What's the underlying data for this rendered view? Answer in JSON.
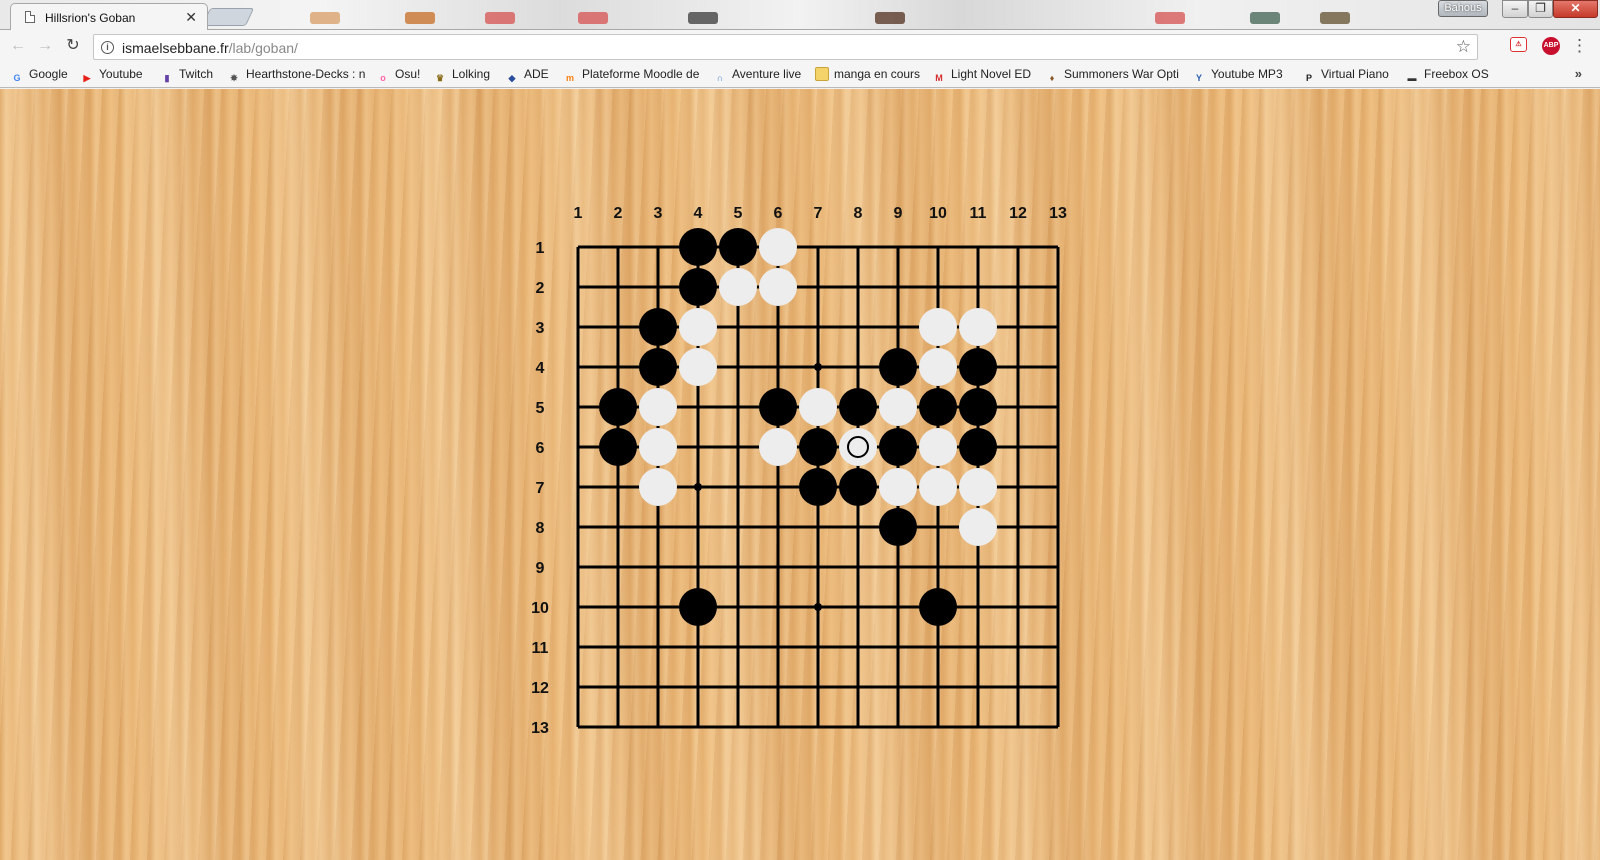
{
  "browser": {
    "tab_title": "Hillsrion's Goban",
    "tab_close": "✕",
    "user_button": "Bahous",
    "url_host": "ismaelsebbane.fr",
    "url_path": "/lab/goban/",
    "ext_abp": "ABP"
  },
  "bookmarks": [
    {
      "label": "Google",
      "icon": "google-icon",
      "color": "#4285f4",
      "glyph": "G"
    },
    {
      "label": "Youtube",
      "icon": "youtube-icon",
      "color": "#e62117",
      "glyph": "▶"
    },
    {
      "label": "Twitch",
      "icon": "twitch-icon",
      "color": "#6441a5",
      "glyph": "▮"
    },
    {
      "label": "Hearthstone-Decks : n",
      "icon": "hearthstone-icon",
      "color": "#555555",
      "glyph": "✸"
    },
    {
      "label": "Osu!",
      "icon": "osu-icon",
      "color": "#ff66aa",
      "glyph": "o"
    },
    {
      "label": "Lolking",
      "icon": "crown-icon",
      "color": "#8a6d1a",
      "glyph": "♛"
    },
    {
      "label": "ADE",
      "icon": "ade-icon",
      "color": "#2a4d9e",
      "glyph": "◆"
    },
    {
      "label": "Plateforme Moodle de",
      "icon": "moodle-icon",
      "color": "#f98012",
      "glyph": "m"
    },
    {
      "label": "Aventure live",
      "icon": "aventure-icon",
      "color": "#3a7dd8",
      "glyph": "∩"
    },
    {
      "label": "manga en cours",
      "icon": "folder-icon",
      "color": "#f4d36b",
      "glyph": ""
    },
    {
      "label": "Light Novel ED",
      "icon": "lightnovel-icon",
      "color": "#d32f2f",
      "glyph": "M"
    },
    {
      "label": "Summoners War Opti",
      "icon": "summoners-icon",
      "color": "#8a5a2b",
      "glyph": "♦"
    },
    {
      "label": "Youtube MP3",
      "icon": "yt-mp3-icon",
      "color": "#2a5db0",
      "glyph": "Y"
    },
    {
      "label": "Virtual Piano",
      "icon": "piano-icon",
      "color": "#222222",
      "glyph": "P"
    },
    {
      "label": "Freebox OS",
      "icon": "freebox-icon",
      "color": "#333333",
      "glyph": "▬"
    }
  ],
  "goban": {
    "size": 13,
    "col_labels": [
      "1",
      "2",
      "3",
      "4",
      "5",
      "6",
      "7",
      "8",
      "9",
      "10",
      "11",
      "12",
      "13"
    ],
    "row_labels": [
      "1",
      "2",
      "3",
      "4",
      "5",
      "6",
      "7",
      "8",
      "9",
      "10",
      "11",
      "12",
      "13"
    ],
    "hoshi": [
      [
        7,
        4
      ],
      [
        4,
        7
      ],
      [
        7,
        10
      ]
    ],
    "black_stones": [
      [
        4,
        1
      ],
      [
        5,
        1
      ],
      [
        4,
        2
      ],
      [
        3,
        3
      ],
      [
        3,
        4
      ],
      [
        9,
        4
      ],
      [
        11,
        4
      ],
      [
        2,
        5
      ],
      [
        6,
        5
      ],
      [
        8,
        5
      ],
      [
        10,
        5
      ],
      [
        11,
        5
      ],
      [
        2,
        6
      ],
      [
        7,
        6
      ],
      [
        9,
        6
      ],
      [
        11,
        6
      ],
      [
        7,
        7
      ],
      [
        8,
        7
      ],
      [
        9,
        8
      ],
      [
        4,
        10
      ],
      [
        10,
        10
      ]
    ],
    "white_stones": [
      [
        6,
        1
      ],
      [
        5,
        2
      ],
      [
        6,
        2
      ],
      [
        4,
        3
      ],
      [
        10,
        3
      ],
      [
        11,
        3
      ],
      [
        4,
        4
      ],
      [
        10,
        4
      ],
      [
        3,
        5
      ],
      [
        7,
        5
      ],
      [
        9,
        5
      ],
      [
        3,
        6
      ],
      [
        6,
        6
      ],
      [
        8,
        6
      ],
      [
        10,
        6
      ],
      [
        3,
        7
      ],
      [
        9,
        7
      ],
      [
        10,
        7
      ],
      [
        11,
        7
      ],
      [
        11,
        8
      ]
    ],
    "last_move": [
      8,
      6
    ],
    "colors": {
      "black": "#000000",
      "white": "#ededed",
      "line": "#000000"
    }
  }
}
